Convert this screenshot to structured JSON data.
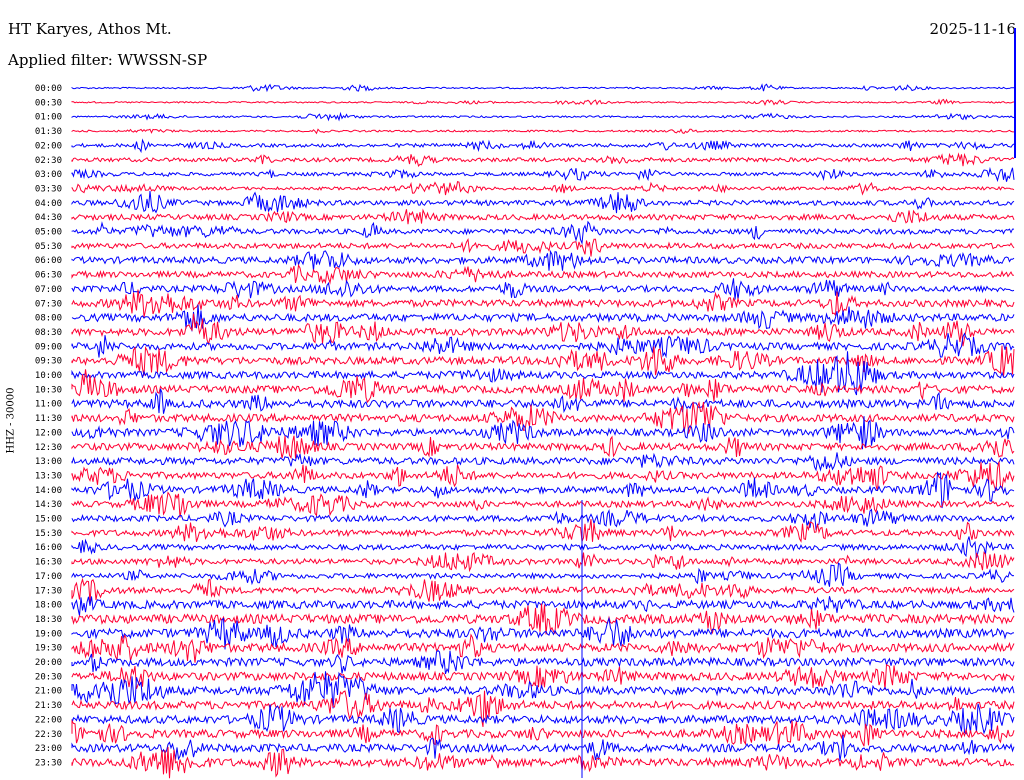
{
  "header": {
    "station": "HT Karyes, Athos Mt.",
    "filter": "Applied filter: WWSSN-SP",
    "date": "2025-11-16",
    "channel": "HHZ - 30000"
  },
  "colors": {
    "trace_even": "#0000ff",
    "trace_odd": "#ff0033",
    "background": "#ffffff",
    "text": "#000000"
  },
  "chart_data": {
    "type": "helicorder",
    "rows": [
      {
        "label": "00:00",
        "amp": 1.5
      },
      {
        "label": "00:30",
        "amp": 1.5
      },
      {
        "label": "01:00",
        "amp": 1.8
      },
      {
        "label": "01:30",
        "amp": 1.8
      },
      {
        "label": "02:00",
        "amp": 3.5
      },
      {
        "label": "02:30",
        "amp": 4.0
      },
      {
        "label": "03:00",
        "amp": 3.5
      },
      {
        "label": "03:30",
        "amp": 3.0
      },
      {
        "label": "04:00",
        "amp": 5.0
      },
      {
        "label": "04:30",
        "amp": 5.5
      },
      {
        "label": "05:00",
        "amp": 5.0
      },
      {
        "label": "05:30",
        "amp": 5.5
      },
      {
        "label": "06:00",
        "amp": 6.5
      },
      {
        "label": "06:30",
        "amp": 6.0
      },
      {
        "label": "07:00",
        "amp": 6.0
      },
      {
        "label": "07:30",
        "amp": 7.0
      },
      {
        "label": "08:00",
        "amp": 7.5
      },
      {
        "label": "08:30",
        "amp": 7.0
      },
      {
        "label": "09:00",
        "amp": 7.0
      },
      {
        "label": "09:30",
        "amp": 7.5
      },
      {
        "label": "10:00",
        "amp": 7.0
      },
      {
        "label": "10:30",
        "amp": 7.5
      },
      {
        "label": "11:00",
        "amp": 8.0
      },
      {
        "label": "11:30",
        "amp": 7.5
      },
      {
        "label": "12:00",
        "amp": 7.0
      },
      {
        "label": "12:30",
        "amp": 7.0
      },
      {
        "label": "13:00",
        "amp": 7.0
      },
      {
        "label": "13:30",
        "amp": 6.5
      },
      {
        "label": "14:00",
        "amp": 6.5
      },
      {
        "label": "14:30",
        "amp": 6.0
      },
      {
        "label": "15:00",
        "amp": 6.0
      },
      {
        "label": "15:30",
        "amp": 6.0
      },
      {
        "label": "16:00",
        "amp": 5.5
      },
      {
        "label": "16:30",
        "amp": 5.5
      },
      {
        "label": "17:00",
        "amp": 5.0
      },
      {
        "label": "17:30",
        "amp": 6.0
      },
      {
        "label": "18:00",
        "amp": 8.0
      },
      {
        "label": "18:30",
        "amp": 9.0
      },
      {
        "label": "19:00",
        "amp": 9.0
      },
      {
        "label": "19:30",
        "amp": 8.5
      },
      {
        "label": "20:00",
        "amp": 8.0
      },
      {
        "label": "20:30",
        "amp": 8.0
      },
      {
        "label": "21:00",
        "amp": 8.0
      },
      {
        "label": "21:30",
        "amp": 8.0
      },
      {
        "label": "22:00",
        "amp": 8.0
      },
      {
        "label": "22:30",
        "amp": 8.0
      },
      {
        "label": "23:00",
        "amp": 8.0
      },
      {
        "label": "23:30",
        "amp": 8.0
      }
    ]
  }
}
